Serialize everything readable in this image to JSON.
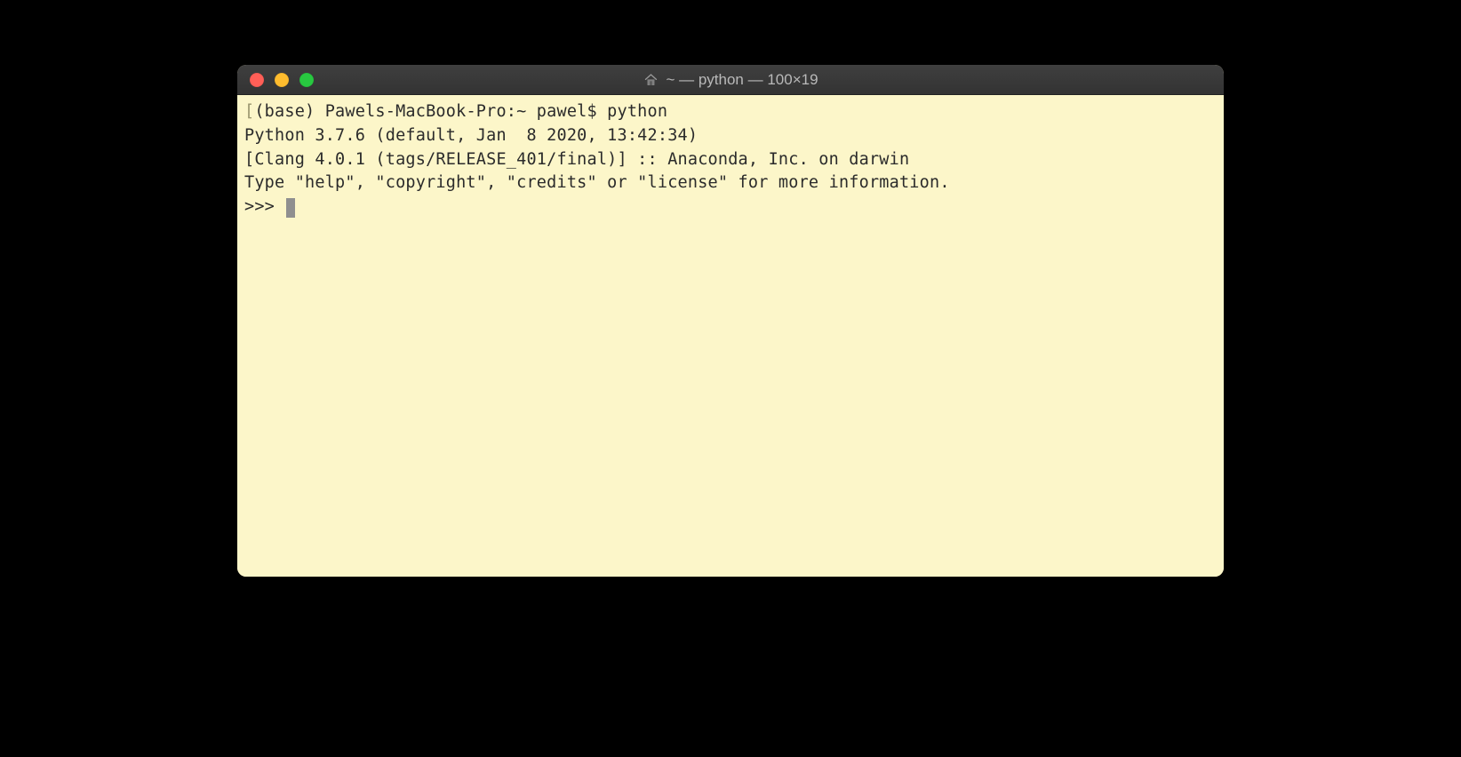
{
  "window": {
    "title": "~ — python — 100×19"
  },
  "terminal": {
    "open_bracket": "[",
    "close_bracket": "]",
    "prompt_line": "(base) Pawels-MacBook-Pro:~ pawel$ python",
    "lines": [
      "Python 3.7.6 (default, Jan  8 2020, 13:42:34)",
      "[Clang 4.0.1 (tags/RELEASE_401/final)] :: Anaconda, Inc. on darwin",
      "Type \"help\", \"copyright\", \"credits\" or \"license\" for more information."
    ],
    "repl_prompt": ">>> "
  },
  "icons": {
    "home": "home-icon"
  }
}
